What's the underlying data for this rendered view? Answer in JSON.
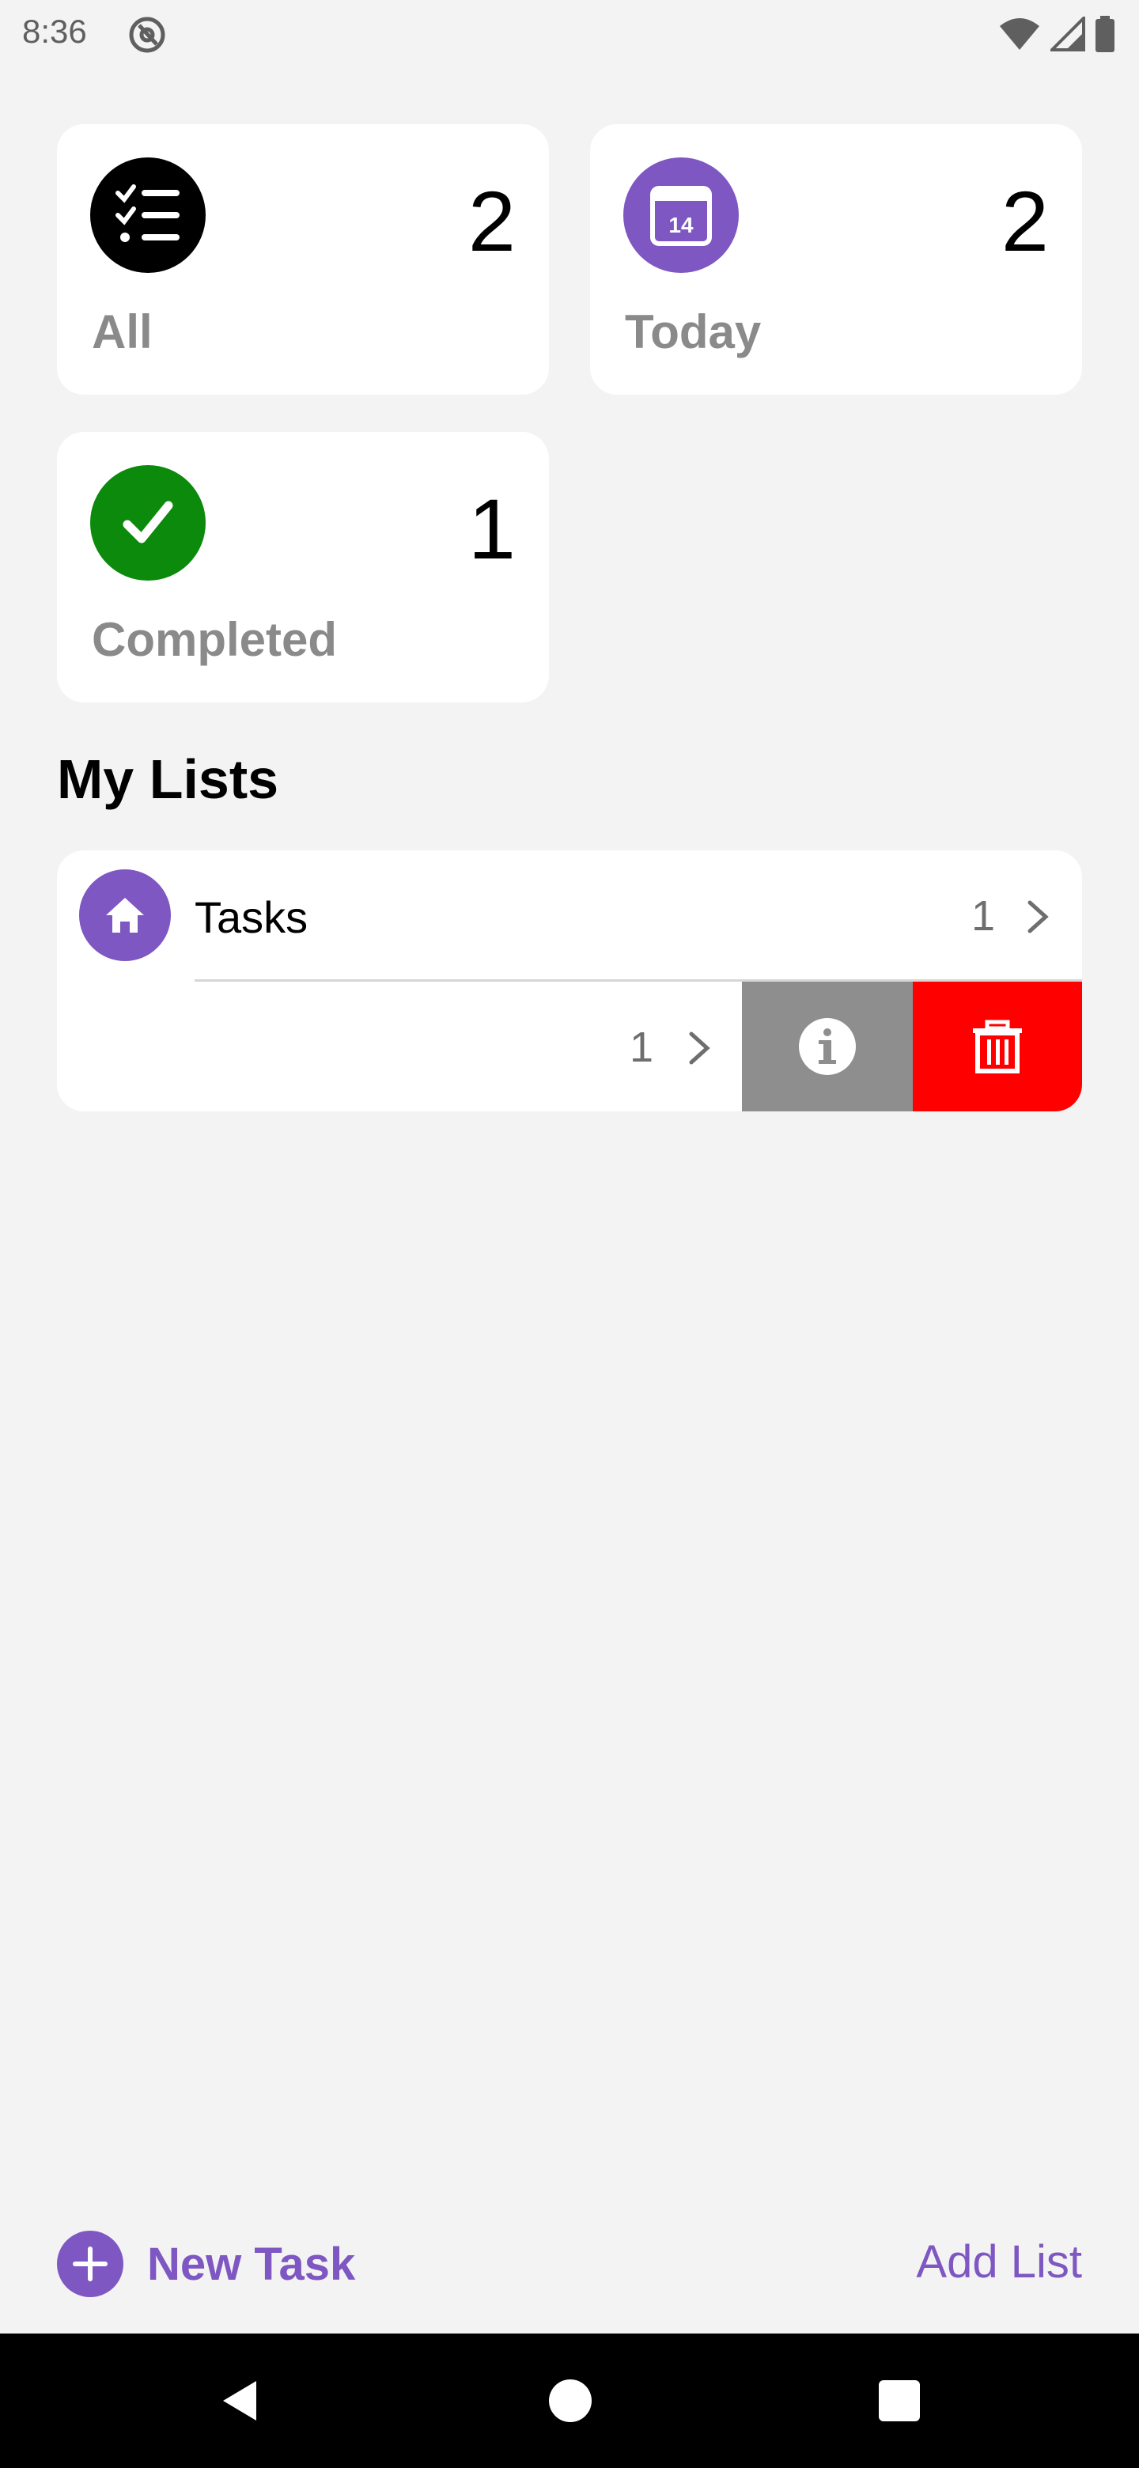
{
  "status_bar": {
    "time": "8:36"
  },
  "summary_cards": [
    {
      "label": "All",
      "count": "2",
      "icon": "checklist-icon",
      "color": "#000000"
    },
    {
      "label": "Today",
      "count": "2",
      "icon": "calendar-icon",
      "calendar_day": "14",
      "color": "#7e57c2"
    },
    {
      "label": "Completed",
      "count": "1",
      "icon": "checkmark-icon",
      "color": "#0b8a0b"
    }
  ],
  "my_lists": {
    "title": "My Lists",
    "items": [
      {
        "name": "Tasks",
        "count": "1",
        "icon": "home-icon",
        "color": "#7e57c2"
      },
      {
        "name": "",
        "count": "1",
        "swipe_actions": [
          "info-icon",
          "trash-icon"
        ]
      }
    ]
  },
  "bottom_toolbar": {
    "new_task_label": "New Task",
    "add_list_label": "Add List",
    "accent": "#7e57c2"
  },
  "colors": {
    "info_action": "#8e8e8e",
    "delete_action": "#ff0000"
  }
}
